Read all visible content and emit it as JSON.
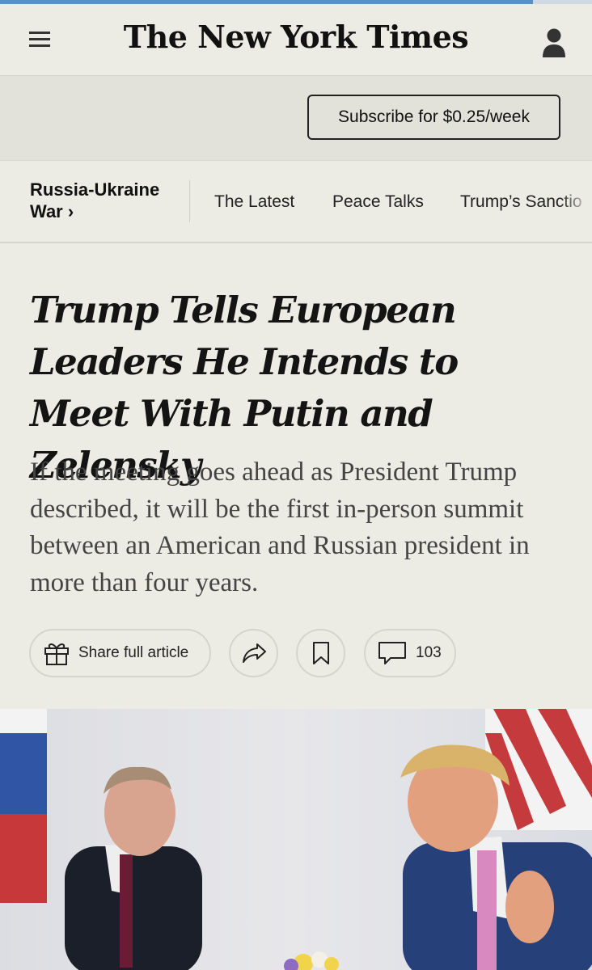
{
  "brand": {
    "logo_text": "The New York Times"
  },
  "header": {
    "menu_icon": "hamburger-menu-icon",
    "account_icon": "account-person-icon",
    "load_progress": 0.9
  },
  "subscribe": {
    "label": "Subscribe for $0.25/week"
  },
  "section_nav": {
    "section_title": "Russia-Ukraine",
    "section_title_line2": "War",
    "chevron": "›",
    "links": [
      "The Latest",
      "Peace Talks",
      "Trump’s Sanctio"
    ]
  },
  "article": {
    "headline": "Trump Tells European Leaders He Intends to Meet With Putin and Zelensky",
    "summary": "If the meeting goes ahead as President Trump described, it will be the first in-person summit between an American and Russian president in more than four years."
  },
  "actions": {
    "share_label": "Share full article",
    "share_icon": "gift-icon",
    "forward_icon": "share-arrow-icon",
    "bookmark_icon": "bookmark-icon",
    "comment_icon": "comment-bubble-icon",
    "comment_count": "103"
  },
  "colors": {
    "background": "#ecece4",
    "band": "#e2e2da",
    "progress": "#5a8fc0"
  }
}
